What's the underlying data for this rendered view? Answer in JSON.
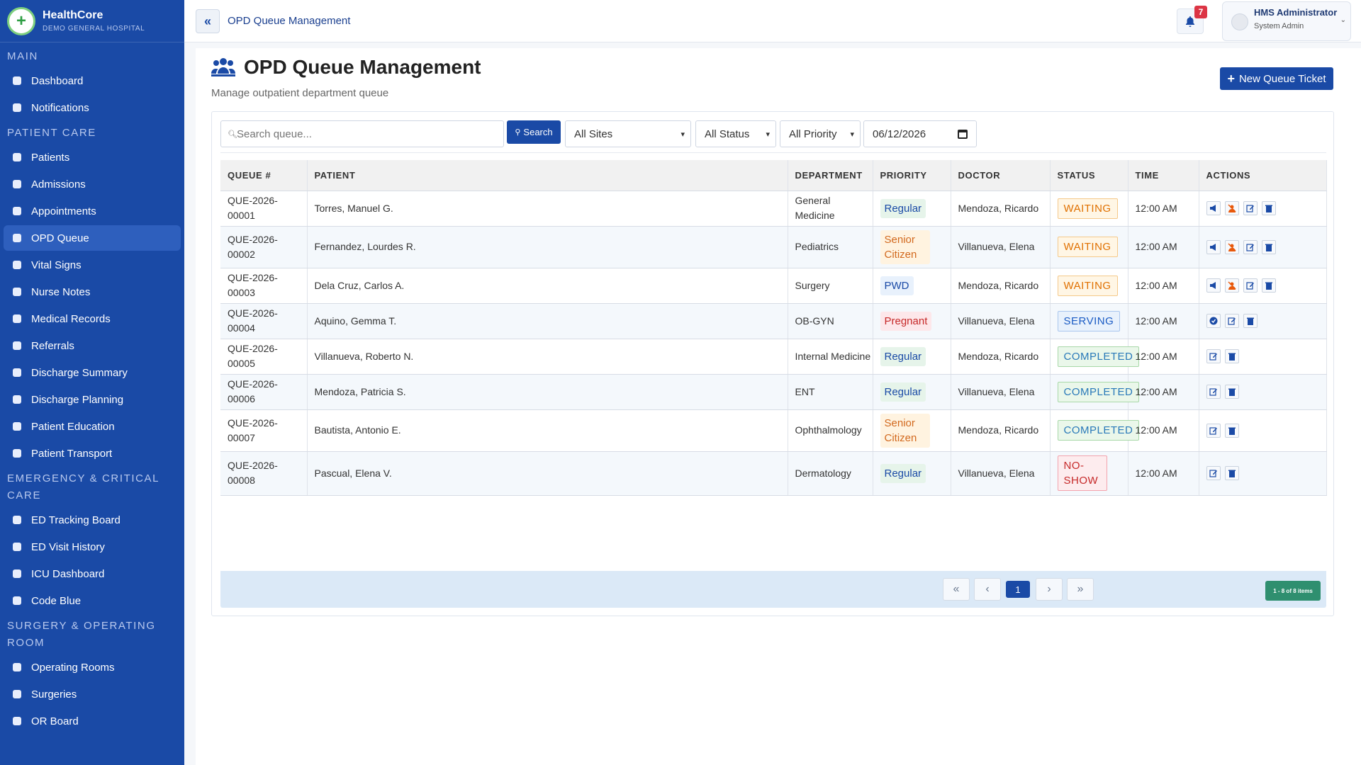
{
  "brand": {
    "name": "HealthCore",
    "subtitle": "DEMO GENERAL HOSPITAL"
  },
  "sidebar": {
    "sections": [
      {
        "title": "MAIN",
        "items": [
          {
            "label": "Dashboard",
            "icon": "dashboard-icon"
          },
          {
            "label": "Notifications",
            "icon": "bell-icon"
          }
        ]
      },
      {
        "title": "PATIENT CARE",
        "items": [
          {
            "label": "Patients",
            "icon": "patients-icon"
          },
          {
            "label": "Admissions",
            "icon": "bed-icon"
          },
          {
            "label": "Appointments",
            "icon": "calendar-icon"
          },
          {
            "label": "OPD Queue",
            "icon": "users-icon",
            "active": true
          },
          {
            "label": "Vital Signs",
            "icon": "heartbeat-icon"
          },
          {
            "label": "Nurse Notes",
            "icon": "notes-icon"
          },
          {
            "label": "Medical Records",
            "icon": "records-icon"
          },
          {
            "label": "Referrals",
            "icon": "arrows-icon"
          },
          {
            "label": "Discharge Summary",
            "icon": "clipboard-icon"
          },
          {
            "label": "Discharge Planning",
            "icon": "planning-icon"
          },
          {
            "label": "Patient Education",
            "icon": "education-icon"
          },
          {
            "label": "Patient Transport",
            "icon": "ambulance-icon"
          }
        ]
      },
      {
        "title": "EMERGENCY & CRITICAL CARE",
        "items": [
          {
            "label": "ED Tracking Board",
            "icon": "hospital-icon"
          },
          {
            "label": "ED Visit History",
            "icon": "ambulance-icon"
          },
          {
            "label": "ICU Dashboard",
            "icon": "heartbeat-icon"
          },
          {
            "label": "Code Blue",
            "icon": "heartbeat-icon"
          }
        ]
      },
      {
        "title": "SURGERY & OPERATING ROOM",
        "items": [
          {
            "label": "Operating Rooms",
            "icon": "door-icon"
          },
          {
            "label": "Surgeries",
            "icon": "heartbeat-icon"
          },
          {
            "label": "OR Board",
            "icon": "monitor-icon"
          }
        ]
      }
    ]
  },
  "topbar": {
    "title": "OPD Queue Management",
    "notification_count": "7",
    "user_name": "HMS Administrator",
    "user_role": "System Admin"
  },
  "page": {
    "title": "OPD Queue Management",
    "subtitle": "Manage outpatient department queue",
    "new_button": "New Queue Ticket"
  },
  "filters": {
    "search_placeholder": "Search queue...",
    "search_button": "Search",
    "site": "All Sites",
    "status": "All Status",
    "priority": "All Priority",
    "date": "06/12/2026"
  },
  "table": {
    "headers": [
      "QUEUE #",
      "PATIENT",
      "DEPARTMENT",
      "PRIORITY",
      "DOCTOR",
      "STATUS",
      "TIME",
      "ACTIONS"
    ],
    "rows": [
      {
        "queue": "QUE-2026-00001",
        "patient": "Torres, Manuel G.",
        "department": "General Medicine",
        "priority": "Regular",
        "doctor": "Mendoza, Ricardo",
        "status": "WAITING",
        "time": "12:00 AM"
      },
      {
        "queue": "QUE-2026-00002",
        "patient": "Fernandez, Lourdes R.",
        "department": "Pediatrics",
        "priority": "Senior Citizen",
        "doctor": "Villanueva, Elena",
        "status": "WAITING",
        "time": "12:00 AM"
      },
      {
        "queue": "QUE-2026-00003",
        "patient": "Dela Cruz, Carlos A.",
        "department": "Surgery",
        "priority": "PWD",
        "doctor": "Mendoza, Ricardo",
        "status": "WAITING",
        "time": "12:00 AM"
      },
      {
        "queue": "QUE-2026-00004",
        "patient": "Aquino, Gemma T.",
        "department": "OB-GYN",
        "priority": "Pregnant",
        "doctor": "Villanueva, Elena",
        "status": "SERVING",
        "time": "12:00 AM"
      },
      {
        "queue": "QUE-2026-00005",
        "patient": "Villanueva, Roberto N.",
        "department": "Internal Medicine",
        "priority": "Regular",
        "doctor": "Mendoza, Ricardo",
        "status": "COMPLETED",
        "time": "12:00 AM"
      },
      {
        "queue": "QUE-2026-00006",
        "patient": "Mendoza, Patricia S.",
        "department": "ENT",
        "priority": "Regular",
        "doctor": "Villanueva, Elena",
        "status": "COMPLETED",
        "time": "12:00 AM"
      },
      {
        "queue": "QUE-2026-00007",
        "patient": "Bautista, Antonio E.",
        "department": "Ophthalmology",
        "priority": "Senior Citizen",
        "doctor": "Mendoza, Ricardo",
        "status": "COMPLETED",
        "time": "12:00 AM"
      },
      {
        "queue": "QUE-2026-00008",
        "patient": "Pascual, Elena V.",
        "department": "Dermatology",
        "priority": "Regular",
        "doctor": "Villanueva, Elena",
        "status": "NO-SHOW",
        "time": "12:00 AM"
      }
    ]
  },
  "pagination": {
    "first": "«",
    "prev": "‹",
    "current": "1",
    "next": "›",
    "last": "»",
    "info": "1 - 8 of 8 items"
  },
  "colors": {
    "sidebar": "#1a4aa6",
    "accent": "#1a4aa6"
  }
}
